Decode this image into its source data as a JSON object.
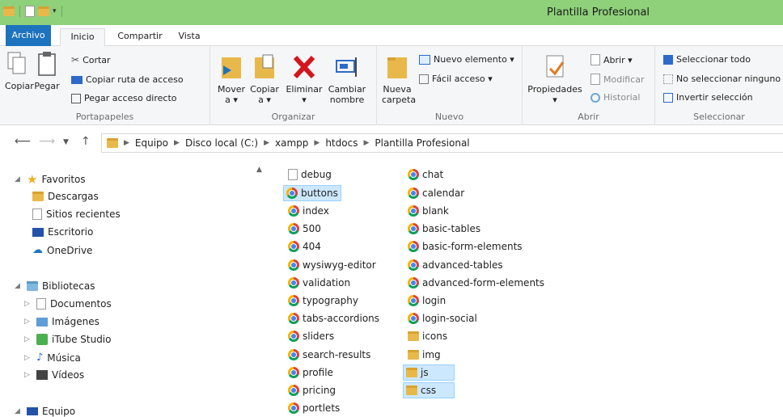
{
  "window": {
    "title": "Plantilla Profesional"
  },
  "tabs": [
    "Archivo",
    "Inicio",
    "Compartir",
    "Vista"
  ],
  "ribbon": {
    "portapapeles": {
      "title": "Portapapeles",
      "copiar": "Copiar",
      "pegar": "Pegar",
      "cortar": "Cortar",
      "copiar_ruta": "Copiar ruta de acceso",
      "pegar_acceso": "Pegar acceso directo"
    },
    "organizar": {
      "title": "Organizar",
      "mover": "Mover",
      "mover2": "a ▾",
      "copiar": "Copiar",
      "copiar2": "a ▾",
      "eliminar": "Eliminar",
      "eliminar2": "▾",
      "cambiar": "Cambiar",
      "cambiar2": "nombre"
    },
    "nuevo": {
      "title": "Nuevo",
      "nueva": "Nueva",
      "nueva2": "carpeta",
      "nuevo_elemento": "Nuevo elemento ▾",
      "facil_acceso": "Fácil acceso ▾"
    },
    "abrir": {
      "title": "Abrir",
      "propiedades": "Propiedades",
      "propiedades2": "▾",
      "abrir": "Abrir ▾",
      "modificar": "Modificar",
      "historial": "Historial"
    },
    "seleccionar": {
      "title": "Seleccionar",
      "todo": "Seleccionar todo",
      "ninguno": "No seleccionar ninguno",
      "invertir": "Invertir selección"
    }
  },
  "address": {
    "path": [
      "Equipo",
      "Disco local (C:)",
      "xampp",
      "htdocs",
      "Plantilla Profesional"
    ]
  },
  "nav": {
    "favoritos": "Favoritos",
    "descargas": "Descargas",
    "sitios": "Sitios recientes",
    "escritorio": "Escritorio",
    "onedrive": "OneDrive",
    "bibliotecas": "Bibliotecas",
    "documentos": "Documentos",
    "imagenes": "Imágenes",
    "itube": "iTube Studio",
    "musica": "Música",
    "videos": "Vídeos",
    "equipo": "Equipo"
  },
  "files_col1": [
    "debug",
    "buttons",
    "index",
    "500",
    "404",
    "wysiwyg-editor",
    "validation",
    "typography",
    "tabs-accordions",
    "sliders",
    "search-results",
    "profile",
    "pricing",
    "portlets"
  ],
  "files_col2": [
    "chat",
    "calendar",
    "blank",
    "basic-tables",
    "basic-form-elements",
    "advanced-tables",
    "advanced-form-elements",
    "login",
    "login-social",
    "icons",
    "img",
    "js",
    "css"
  ]
}
